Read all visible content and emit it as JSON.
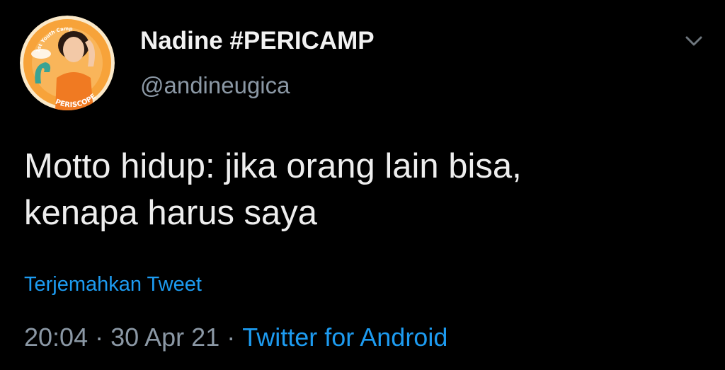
{
  "tweet": {
    "display_name": "Nadine #PERICAMP",
    "handle": "@andineugica",
    "text_lines": [
      "Motto hidup: jika orang lain bisa,",
      "kenapa harus saya"
    ],
    "translate_label": "Terjemahkan Tweet",
    "time": "20:04",
    "separator": "·",
    "date": "30 Apr 21",
    "source": "Twitter for Android"
  },
  "avatar": {
    "badge_top": "1st Youth Camp",
    "badge_bottom": "PERISCOPE"
  },
  "icons": {
    "more": "chevron-down-icon"
  },
  "colors": {
    "background": "#000000",
    "primary_text": "#eeeeee",
    "secondary_text": "#8b98a5",
    "accent": "#1d9bf0",
    "avatar_orange": "#f7a33a"
  }
}
